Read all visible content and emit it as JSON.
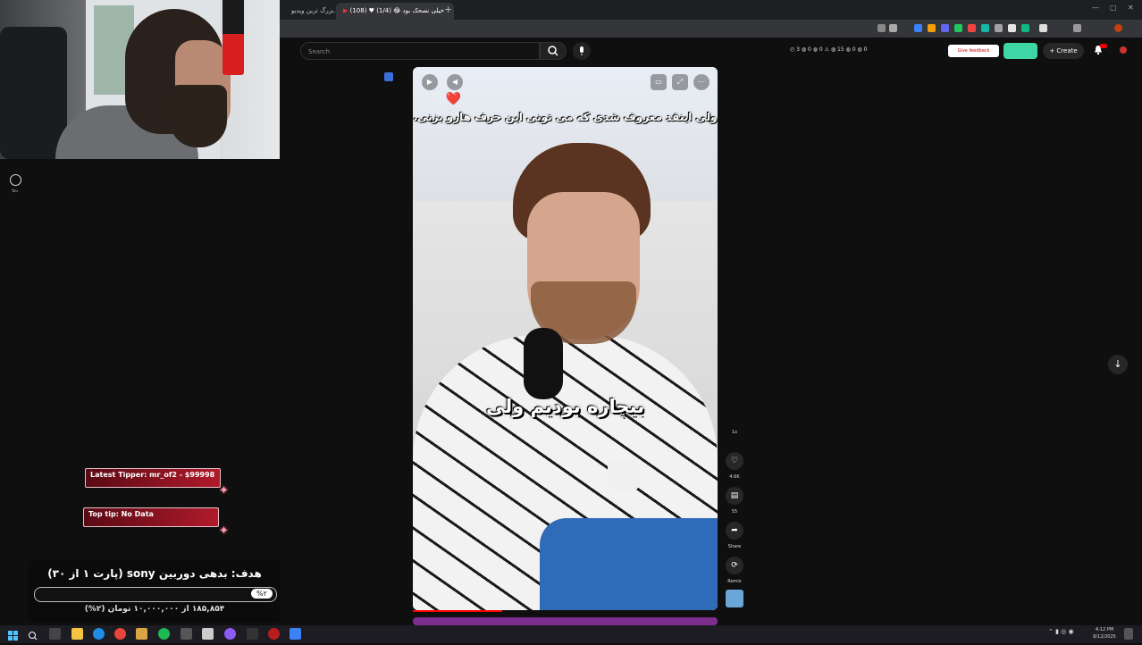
{
  "browser": {
    "tabs": [
      {
        "title": "بزرگ ترین ویدیو..."
      },
      {
        "title": "(108) ♥ خیلی نصحک بود 😂 (1/4)"
      }
    ],
    "new_tab_label": "+"
  },
  "youtube": {
    "search_placeholder": "Search",
    "status_text": "◴ 3  ◍ 0  ◍ 0  ⚠  ◍ 15  ◍ 0  ◍ 0",
    "feedback_label": "Give feedback",
    "create_label": "+ Create",
    "home_label": "You"
  },
  "short": {
    "caption_top": "ولی اینقد معروف شدی که می تونی این حرف هارو بزنی.",
    "caption_mid": "بیچاره بودیم ولی",
    "emoji": "😕❤️",
    "top_label": "1x",
    "actions": [
      {
        "icon": "♡",
        "label": "4.6K"
      },
      {
        "icon": "▤",
        "label": "55"
      },
      {
        "icon": "➦",
        "label": "Share"
      },
      {
        "icon": "⟳",
        "label": "Remix"
      }
    ]
  },
  "stream_overlay": {
    "latest_tipper": "Latest Tipper: mr_of2 - $99998",
    "top_tip": "Top tip: No Data",
    "goal_title": "هدف: بدهی دوربین sony (پارت ۱ از ۳۰)",
    "goal_percent": "%۲",
    "goal_progress": 0.02,
    "goal_sub": "۱۸۵,۸۵۴ از ۱۰,۰۰۰,۰۰۰ تومان (۲%)"
  },
  "taskbar": {
    "time": "4:12 PM",
    "date": "8/12/2025"
  },
  "colors": {
    "overlay_red": "#b01a2b",
    "accent_green": "#3dd6a4",
    "yt_dark": "#0f0f0f"
  }
}
